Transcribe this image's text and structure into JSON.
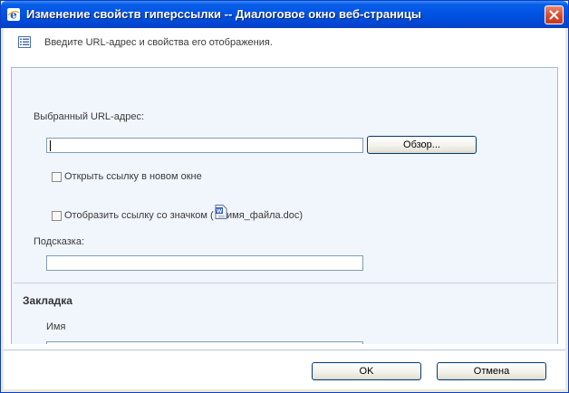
{
  "window": {
    "title": "Изменение свойств гиперссылки -- Диалоговое окно веб-страницы"
  },
  "info": {
    "text": "Введите URL-адрес и свойства его отображения."
  },
  "url_section": {
    "label": "Выбранный URL-адрес:",
    "value": "",
    "browse_label": "Обзор..."
  },
  "options": {
    "open_new_window": "Открыть ссылку в новом окне",
    "show_icon_prefix": "Отобразить ссылку со значком (",
    "show_icon_filename": "имя_файла.doc)"
  },
  "tooltip": {
    "label": "Подсказка:",
    "value": ""
  },
  "bookmark": {
    "heading": "Закладка",
    "name_label": "Имя",
    "name_value": ""
  },
  "footer": {
    "ok_label": "OK",
    "cancel_label": "Отмена"
  }
}
